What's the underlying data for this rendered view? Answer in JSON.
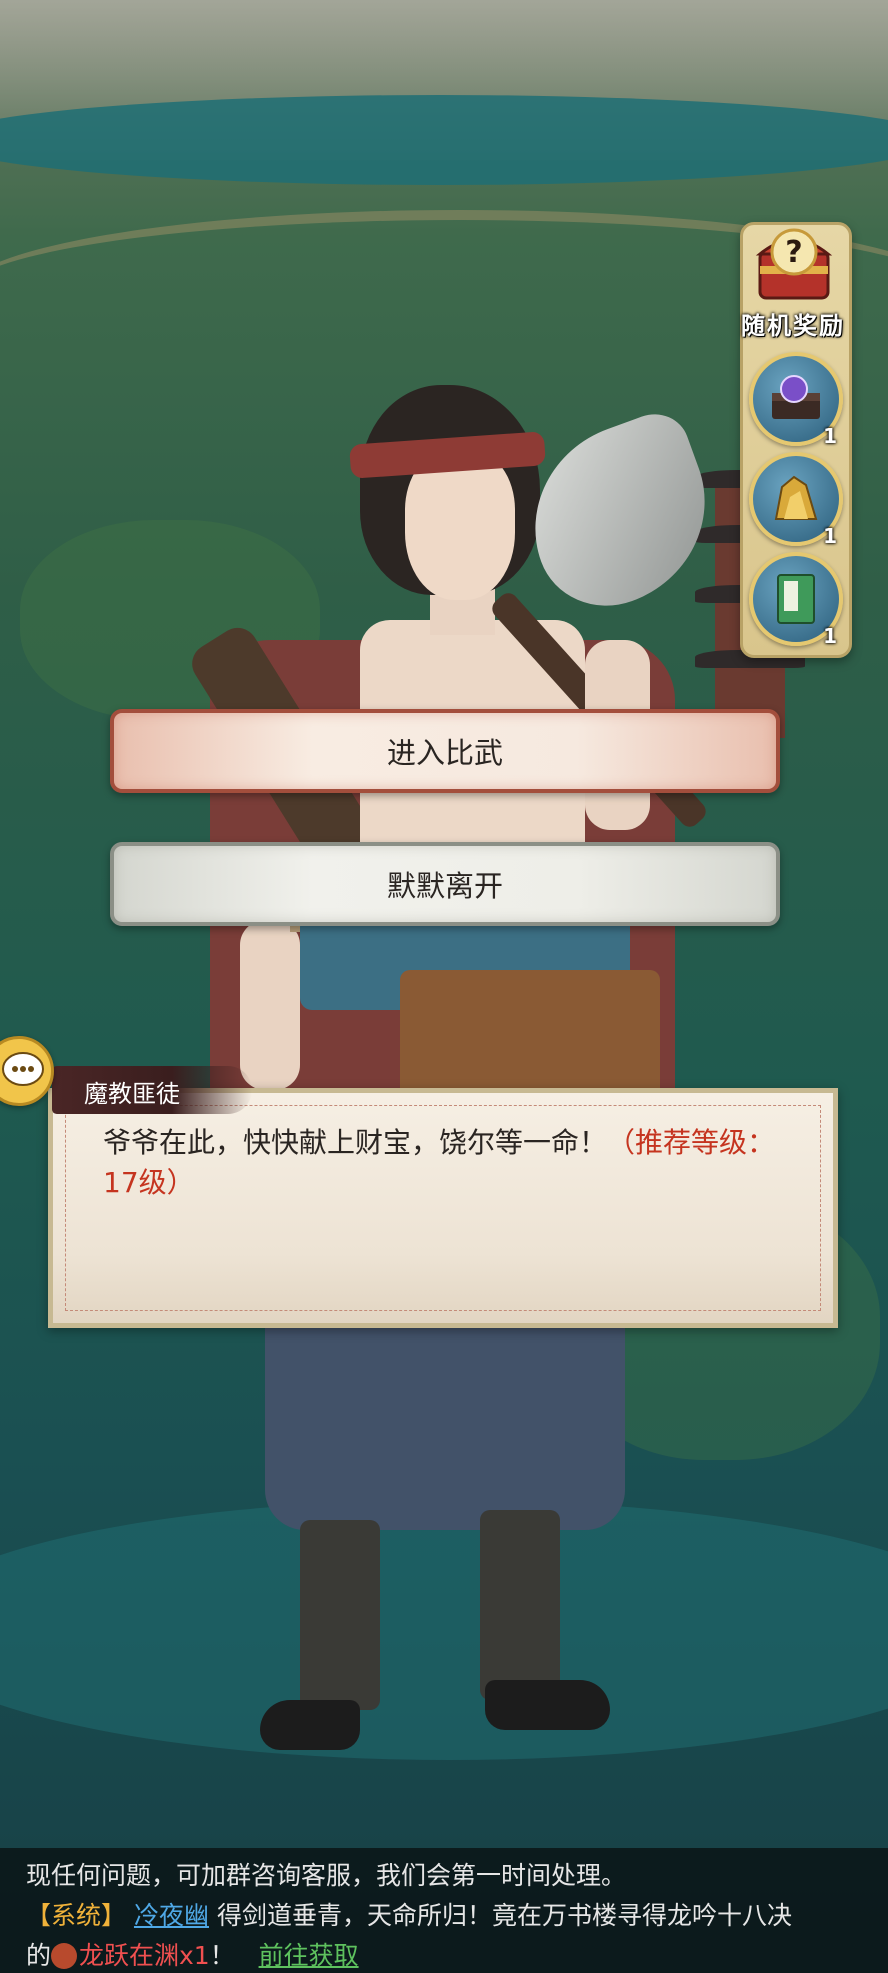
{
  "reward_panel": {
    "title": "随机奖励",
    "items": [
      {
        "icon": "treasure-chest-orb-icon",
        "count": "1"
      },
      {
        "icon": "gold-ore-icon",
        "count": "1"
      },
      {
        "icon": "green-book-icon",
        "count": "1"
      }
    ]
  },
  "choices": {
    "primary": "进入比武",
    "secondary": "默默离开"
  },
  "dialog": {
    "speaker": "魔教匪徒",
    "text": "爷爷在此，快快献上财宝，饶尔等一命！",
    "recommend": "（推荐等级：17级）"
  },
  "system_bar": {
    "line1": "现任何问题，可加群咨询客服，我们会第一时间处理。",
    "tag": "【系统】",
    "player": "冷夜幽",
    "msg": "得剑道垂青，天命所归！竟在万书楼寻得龙吟十八决",
    "prefix": "的",
    "item": "龙跃在渊x1",
    "exclaim": "！",
    "link": "前往获取"
  },
  "colors": {
    "primary_border": "#a34e3c",
    "recommend_text": "#c5341f",
    "system_tag": "#f0b23a",
    "player_name": "#4fa8e6",
    "item_name": "#f05050",
    "link": "#5ec25e"
  }
}
